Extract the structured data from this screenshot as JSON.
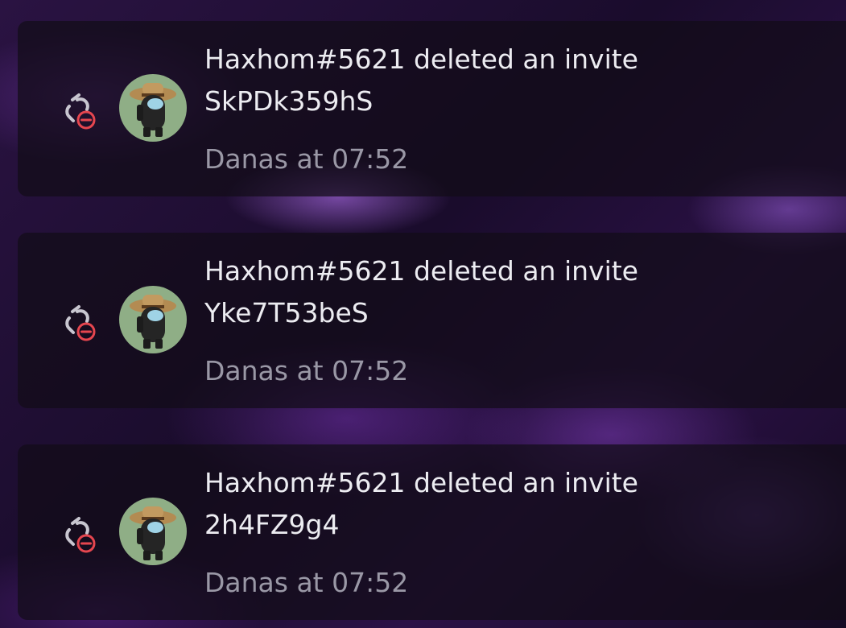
{
  "audit_log": {
    "entries": [
      {
        "user": "Haxhom#5621",
        "action": "deleted an invite",
        "title": "Haxhom#5621 deleted an invite",
        "invite_code": "SkPDk359hS",
        "meta": "Danas at 07:52",
        "icon": "link-remove-icon"
      },
      {
        "user": "Haxhom#5621",
        "action": "deleted an invite",
        "title": "Haxhom#5621 deleted an invite",
        "invite_code": "Yke7T53beS",
        "meta": "Danas at 07:52",
        "icon": "link-remove-icon"
      },
      {
        "user": "Haxhom#5621",
        "action": "deleted an invite",
        "title": "Haxhom#5621 deleted an invite",
        "invite_code": "2h4FZ9g4",
        "meta": "Danas at 07:52",
        "icon": "link-remove-icon"
      }
    ]
  },
  "colors": {
    "text_primary": "#ececf1",
    "text_muted": "#9a98a6",
    "danger_red": "#e6464f",
    "icon_grey": "#c8c6d0",
    "avatar_bg": "#8fae86"
  }
}
